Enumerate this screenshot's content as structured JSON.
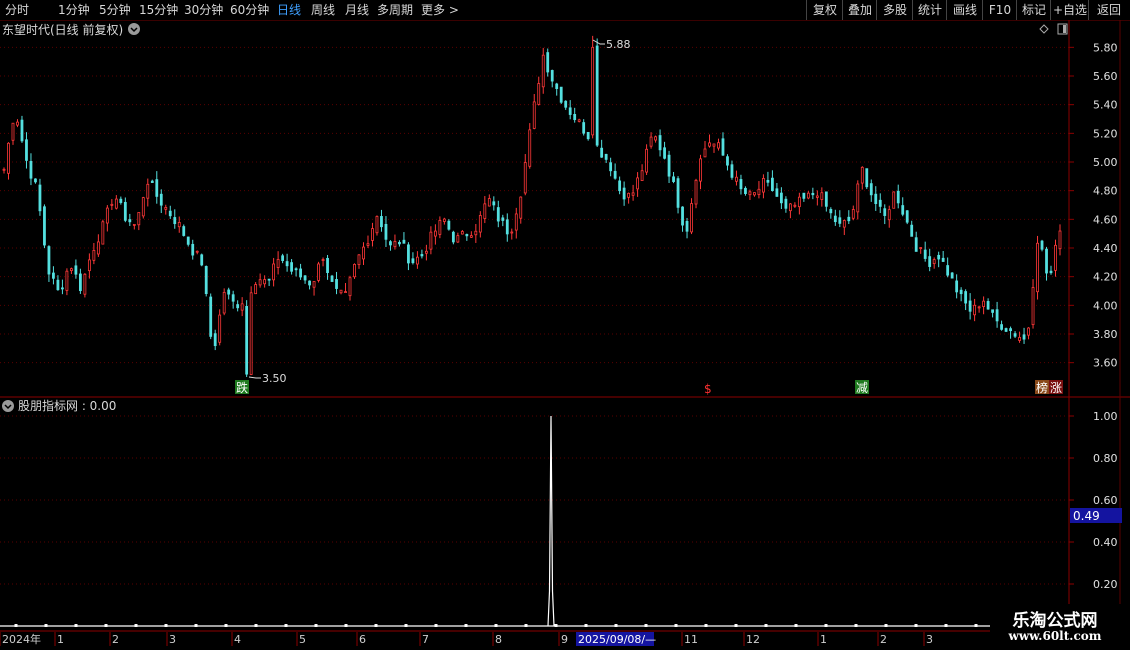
{
  "toolbar": {
    "periods": [
      {
        "label": "分时"
      },
      {
        "label": "1分钟"
      },
      {
        "label": "5分钟"
      },
      {
        "label": "15分钟"
      },
      {
        "label": "30分钟"
      },
      {
        "label": "60分钟"
      },
      {
        "label": "日线",
        "active": true
      },
      {
        "label": "周线"
      },
      {
        "label": "月线"
      },
      {
        "label": "多周期"
      },
      {
        "label": "更多 >"
      }
    ],
    "tools": [
      "复权",
      "叠加",
      "多股",
      "统计",
      "画线",
      "F10",
      "标记",
      "+自选",
      "返回"
    ]
  },
  "main_chart": {
    "title": "东望时代(日线 前复权)",
    "high_label": "5.88",
    "low_label": "3.50",
    "y_ticks": [
      "5.80",
      "5.60",
      "5.40",
      "5.20",
      "5.00",
      "4.80",
      "4.60",
      "4.40",
      "4.20",
      "4.00",
      "3.80",
      "3.60"
    ],
    "markers": [
      {
        "text": "跌",
        "bg": "#1f7a1f",
        "color": "#ffffff"
      },
      {
        "text": "$",
        "bg": "",
        "color": "#ff3030"
      },
      {
        "text": "减",
        "bg": "#1f7a1f",
        "color": "#ffffff"
      },
      {
        "text": "榜",
        "bg": "#8a4a1a",
        "color": "#ffffff"
      },
      {
        "text": "涨",
        "bg": "#7a1010",
        "color": "#ffffff"
      }
    ]
  },
  "indicator": {
    "title": "股朋指标网 : 0.00",
    "y_ticks": [
      "1.00",
      "0.80",
      "0.60",
      "0.40",
      "0.20"
    ],
    "cursor_value": "0.49"
  },
  "time_axis": {
    "labels": [
      "2024年",
      "1",
      "2",
      "3",
      "4",
      "5",
      "6",
      "7",
      "8",
      "9",
      "11",
      "12",
      "1",
      "2",
      "3"
    ],
    "cursor_date": "2025/09/08/—"
  },
  "watermark": {
    "line1": "乐淘公式网",
    "line2": "www.60lt.com"
  },
  "chart_data": {
    "type": "candlestick",
    "title": "东望时代(日线 前复权)",
    "ylim": [
      3.5,
      5.9
    ],
    "high": 5.88,
    "low": 3.5,
    "close_path": [
      4.95,
      5.38,
      5.02,
      4.8,
      4.25,
      4.08,
      4.3,
      4.12,
      4.38,
      4.55,
      4.78,
      4.62,
      4.55,
      4.88,
      4.75,
      4.65,
      4.55,
      4.4,
      4.3,
      3.65,
      4.1,
      4.0,
      4.05,
      4.2,
      4.15,
      4.35,
      4.25,
      4.2,
      4.15,
      4.35,
      4.1,
      4.05,
      4.3,
      4.45,
      4.65,
      4.4,
      4.45,
      4.3,
      4.35,
      4.5,
      4.6,
      4.45,
      4.5,
      4.55,
      4.75,
      4.6,
      4.5,
      4.8,
      5.3,
      5.75,
      5.55,
      5.4,
      5.3,
      5.2,
      5.1,
      5.0,
      4.8,
      4.75,
      4.95,
      5.2,
      5.05,
      4.8,
      4.5,
      4.95,
      5.15,
      5.1,
      4.95,
      4.8,
      4.75,
      4.85,
      4.8,
      4.65,
      4.7,
      4.75,
      4.8,
      4.65,
      4.55,
      4.6,
      4.95,
      4.75,
      4.6,
      4.8,
      4.6,
      4.4,
      4.3,
      4.35,
      4.2,
      4.05,
      3.95,
      4.05,
      3.9,
      3.85,
      3.8,
      3.75,
      4.5,
      4.15,
      4.55
    ],
    "indicator_series": {
      "name": "股朋指标网",
      "baseline": 0.0,
      "spike": {
        "position": "2025-09",
        "value": 1.0
      }
    }
  }
}
